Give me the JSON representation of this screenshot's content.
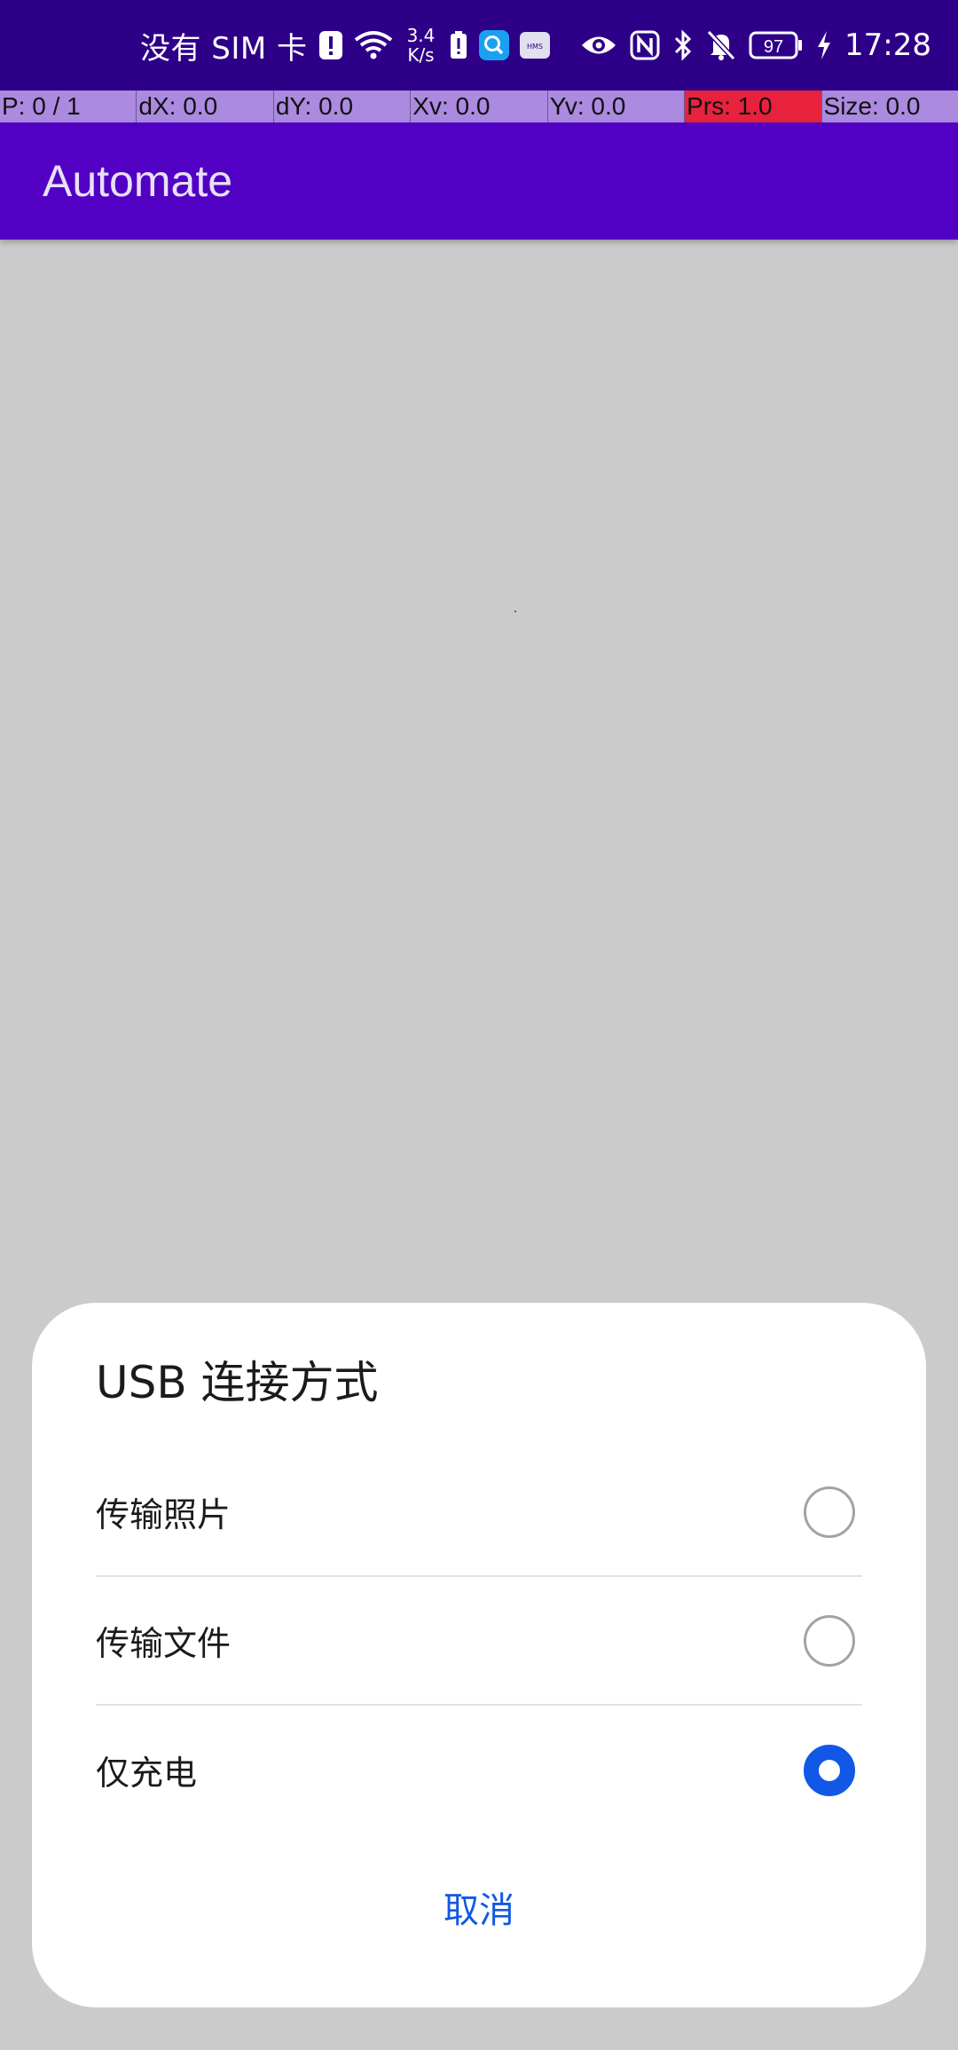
{
  "status_bar": {
    "carrier": "没有 SIM 卡",
    "net_speed_value": "3.4",
    "net_speed_unit": "K/s",
    "battery_level": "97",
    "time": "17:28",
    "icons": [
      "alert-icon",
      "wifi-icon",
      "battery-saver-icon",
      "search-app-icon",
      "hms-icon",
      "eye-icon",
      "nfc-icon",
      "bluetooth-icon",
      "mute-bell-icon",
      "battery-icon",
      "charging-icon"
    ],
    "hms_label": "HMS"
  },
  "pointer_overlay": {
    "cells": [
      "P: 0 / 1",
      "dX: 0.0",
      "dY: 0.0",
      "Xv: 0.0",
      "Yv: 0.0",
      "Prs: 1.0",
      "Size: 0.0"
    ]
  },
  "app_bar": {
    "title": "Automate"
  },
  "dialog": {
    "title": "USB 连接方式",
    "options": [
      {
        "label": "传输照片",
        "checked": false
      },
      {
        "label": "传输文件",
        "checked": false
      },
      {
        "label": "仅充电",
        "checked": true
      }
    ],
    "cancel_label": "取消"
  },
  "colors": {
    "status_bar": "#2e0088",
    "app_bar": "#5100c4",
    "accent": "#1258e6",
    "overlay": "#ab8ae0",
    "overlay_highlight": "#e8223d"
  }
}
